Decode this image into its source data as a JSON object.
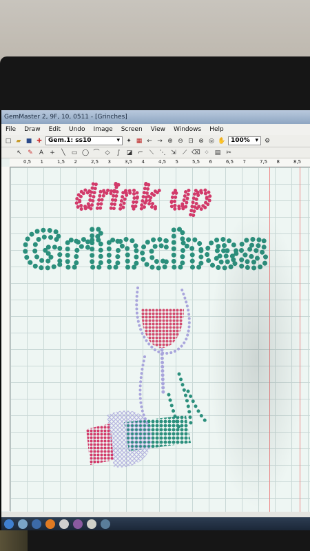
{
  "window": {
    "title": "GemMaster 2, 9F, 10, 0511 - [Grinches]"
  },
  "menu": [
    "File",
    "Draw",
    "Edit",
    "Undo",
    "Image",
    "Screen",
    "View",
    "Windows",
    "Help"
  ],
  "toolbar": {
    "gem_select": "Gem.1: ss10",
    "zoom_select": "100%"
  },
  "ruler": {
    "labels": [
      "0,5",
      "1",
      "1,5",
      "2",
      "2,5",
      "3",
      "3,5",
      "4",
      "4,5",
      "5",
      "5,5",
      "6",
      "6,5",
      "7",
      "7,5",
      "8",
      "8,5"
    ]
  },
  "design": {
    "line1": "drink up",
    "line2": "Grinches"
  },
  "colors": {
    "pink": "#d23a6a",
    "teal": "#2b8f7c",
    "lavender": "#b7b3e6",
    "wine": "#d34b6e"
  }
}
